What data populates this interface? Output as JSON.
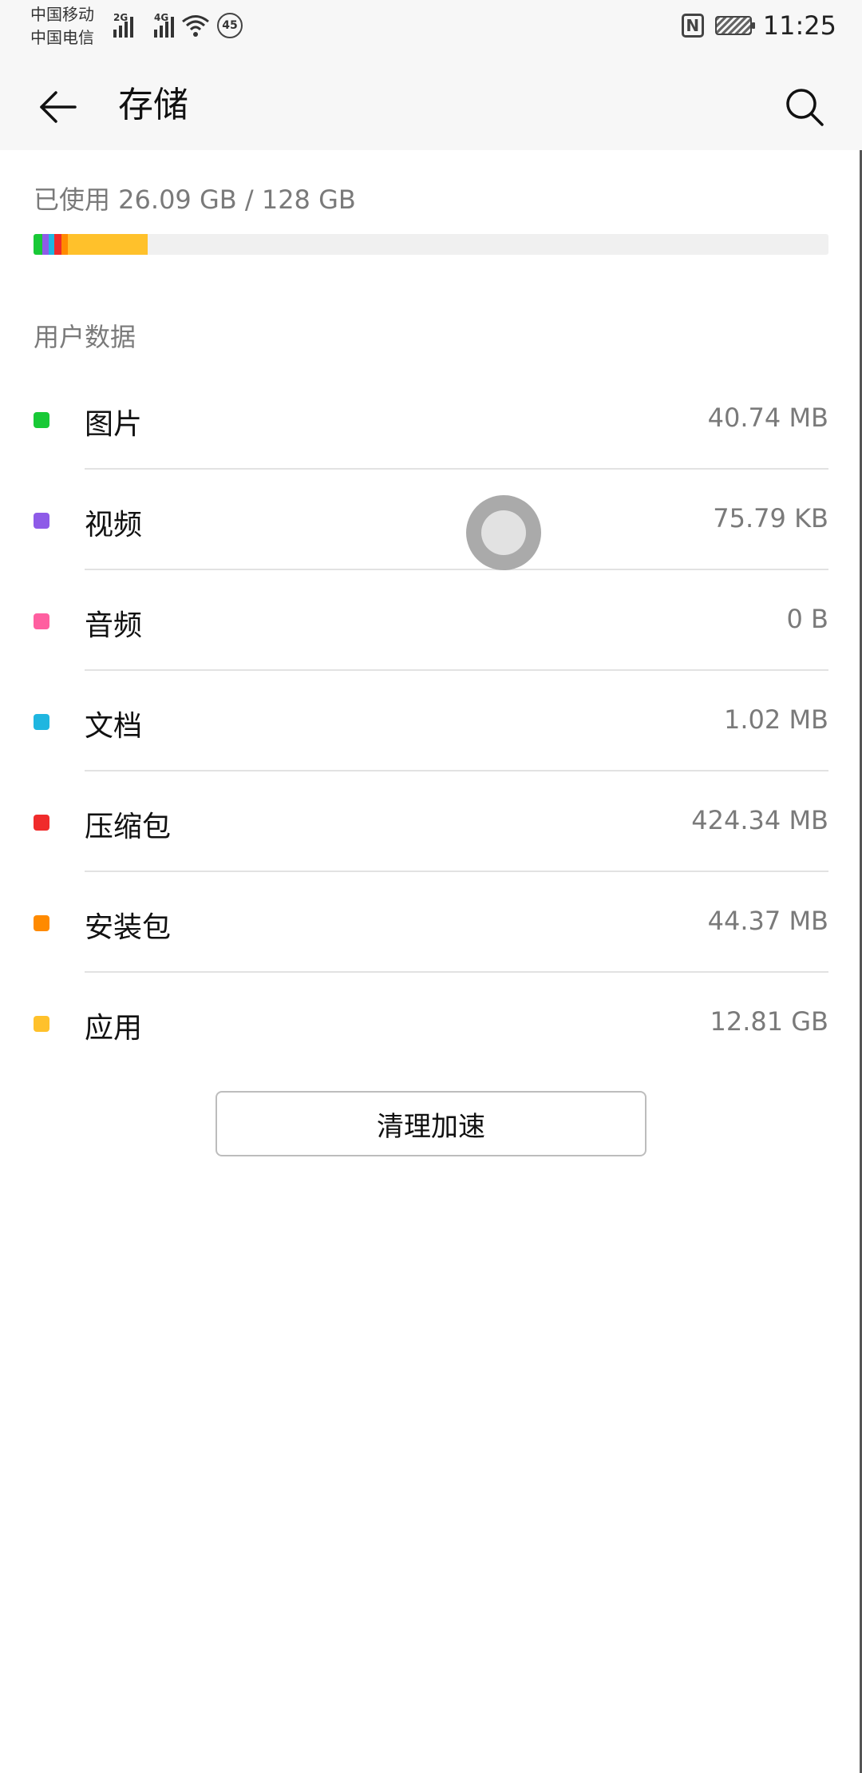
{
  "status_bar": {
    "carrier_1": "中国移动",
    "carrier_2": "中国电信",
    "net_1": "2G",
    "net_2": "4G",
    "badge": "45",
    "nfc": "N",
    "time": "11:25"
  },
  "app_bar": {
    "title": "存储"
  },
  "usage": {
    "text": "已使用 26.09 GB / 128 GB",
    "used_fraction": 0.2038,
    "segments": [
      {
        "name": "图片",
        "color": "#18c936",
        "fraction": 0.0112
      },
      {
        "name": "视频",
        "color": "#8e5be8",
        "fraction": 0.0075
      },
      {
        "name": "文档",
        "color": "#1fb6e0",
        "fraction": 0.0075
      },
      {
        "name": "压缩包",
        "color": "#f02b2b",
        "fraction": 0.0085
      },
      {
        "name": "安装包",
        "color": "#ff8a00",
        "fraction": 0.0085
      },
      {
        "name": "应用",
        "color": "#ffc12b",
        "fraction": 0.1006
      }
    ]
  },
  "section_title": "用户数据",
  "items": [
    {
      "label": "图片",
      "value": "40.74 MB",
      "color": "#18c936"
    },
    {
      "label": "视频",
      "value": "75.79 KB",
      "color": "#8e5be8"
    },
    {
      "label": "音频",
      "value": "0 B",
      "color": "#ff5fa0"
    },
    {
      "label": "文档",
      "value": "1.02 MB",
      "color": "#1fb6e0"
    },
    {
      "label": "压缩包",
      "value": "424.34 MB",
      "color": "#f02b2b"
    },
    {
      "label": "安装包",
      "value": "44.37 MB",
      "color": "#ff8a00"
    },
    {
      "label": "应用",
      "value": "12.81 GB",
      "color": "#ffc12b"
    }
  ],
  "clean_button": {
    "label": "清理加速"
  },
  "icons": {
    "back": "back-arrow-icon",
    "search": "search-icon",
    "wifi": "wifi-icon",
    "battery": "battery-icon",
    "nfc": "nfc-icon"
  }
}
